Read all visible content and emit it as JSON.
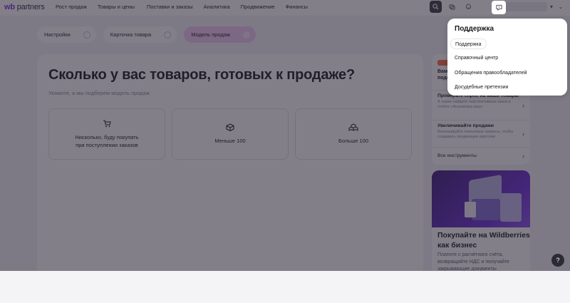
{
  "header": {
    "logo_wb": "wb",
    "logo_partners": "partners",
    "nav": [
      "Рост продаж",
      "Товары и цены",
      "Поставки и заказы",
      "Аналитика",
      "Продвижение",
      "Финансы"
    ],
    "icons": [
      "search-icon",
      "chat-icon",
      "bell-icon",
      "support-icon",
      "chevron-down-icon"
    ]
  },
  "breadcrumbs": [
    "Настройки",
    "Карточка товара",
    "Модель продаж"
  ],
  "main": {
    "title": "Сколько у вас товаров, готовых к продаже?",
    "subtitle": "Укажите, а мы подберем модель продаж",
    "options": [
      {
        "label": "Нисколько, буду покупать\nпри поступлении заказов",
        "icon": "cart-icon"
      },
      {
        "label": "Меньше 100",
        "icon": "box-icon"
      },
      {
        "label": "Больше 100",
        "icon": "boxes-icon"
      }
    ]
  },
  "tools": {
    "promo_title_line1": "Вам",
    "promo_title_line2": "подо",
    "items": [
      {
        "title": "Проверьте спрос на ваши товары",
        "desc": "А также найдите перспективные ниши в отчёте «Аналитика ниш»"
      },
      {
        "title": "Увеличивайте продажи",
        "desc": "Анализируйте поисковые запросы, чтобы создавать продающие карточки"
      },
      {
        "title": "Все инструменты",
        "desc": ""
      }
    ]
  },
  "biz_card": {
    "title": "Покупайте на Wildberries как бизнес",
    "desc": "Платите с расчётного счёта, возвращайте НДС и получайте закрывающие документы"
  },
  "support_menu": {
    "title": "Поддержка",
    "items": [
      "Поддержка",
      "Справочный центр",
      "Обращения правообладателей",
      "Досудебные претензии"
    ],
    "active_index": 0
  },
  "help_fab": "?"
}
